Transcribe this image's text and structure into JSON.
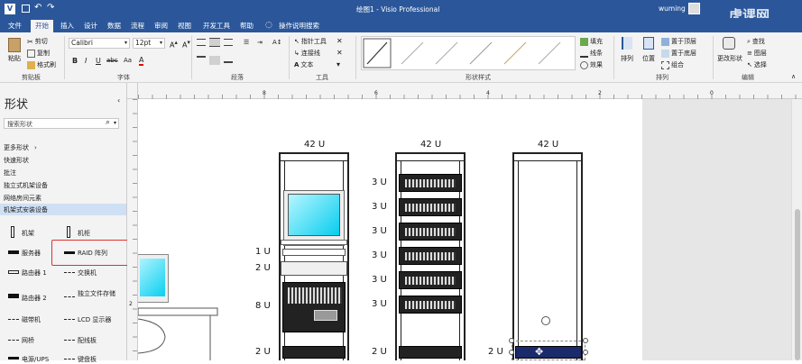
{
  "title": {
    "app": "绘图1 - Visio Professional",
    "user": "wuming",
    "watermark": "虎课网"
  },
  "menu": {
    "tabs": [
      "文件",
      "开始",
      "插入",
      "设计",
      "数据",
      "流程",
      "审阅",
      "视图",
      "开发工具",
      "帮助"
    ],
    "active": "开始",
    "tell_me": "操作说明搜索"
  },
  "ribbon": {
    "clipboard": {
      "paste": "粘贴",
      "cut": "剪切",
      "copy": "复制",
      "format_painter": "格式刷",
      "label": "剪贴板"
    },
    "font": {
      "name": "Calibri",
      "size": "12pt",
      "label": "字体"
    },
    "paragraph": {
      "label": "段落"
    },
    "tools": {
      "pointer": "指针工具",
      "connector": "连接线",
      "text": "文本",
      "label": "工具"
    },
    "shape_styles": {
      "fill": "填充",
      "line": "线条",
      "effects": "效果",
      "label": "形状样式"
    },
    "arrange": {
      "align": "排列",
      "position": "位置",
      "bring_front": "置于顶层",
      "send_back": "置于底层",
      "group": "组合",
      "label": "排列"
    },
    "editing": {
      "change_shape": "更改形状",
      "find": "查找",
      "layers": "图层",
      "select": "选择",
      "label": "编辑"
    }
  },
  "shapes_panel": {
    "title": "形状",
    "search_placeholder": "搜索形状",
    "links": [
      "更多形状",
      "快速形状",
      "批注",
      "独立式机架设备",
      "网络房间元素",
      "机架式安装设备"
    ],
    "selected_link": "机架式安装设备",
    "stencils": [
      {
        "left": "机架",
        "right": "机柜"
      },
      {
        "left": "服务器",
        "right": "RAID 阵列"
      },
      {
        "left": "路由器 1",
        "right": "交换机"
      },
      {
        "left": "路由器 2",
        "right": "独立文件存储"
      },
      {
        "left": "磁带机",
        "right": "LCD 显示器"
      },
      {
        "left": "网桥",
        "right": "配线板"
      },
      {
        "left": "电源/UPS",
        "right": "键盘板"
      }
    ]
  },
  "ruler": {
    "marks": [
      "8",
      "6",
      "4",
      "2",
      "0",
      "2"
    ]
  },
  "diagram": {
    "racks": [
      {
        "height_label": "42 U",
        "units": [
          "1 U",
          "2 U",
          "8 U",
          "2 U"
        ]
      },
      {
        "height_label": "42 U",
        "units": [
          "3 U",
          "3 U",
          "3 U",
          "3 U",
          "3 U",
          "3 U",
          "2 U"
        ]
      },
      {
        "height_label": "42 U",
        "units": [
          "2 U"
        ]
      }
    ]
  }
}
